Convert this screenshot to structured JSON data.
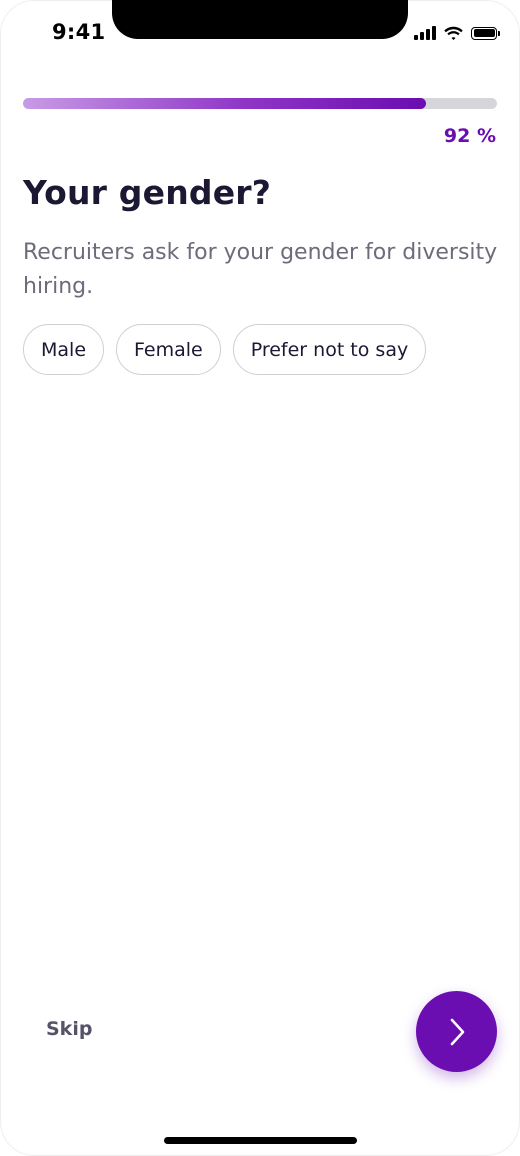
{
  "status_bar": {
    "time": "9:41",
    "signal_icon": "cellular-signal-icon",
    "wifi_icon": "wifi-icon",
    "battery_icon": "battery-icon"
  },
  "progress": {
    "value_percent": 92,
    "label": "92 %",
    "fill_color": "#6a0db1"
  },
  "question": {
    "title": "Your gender?",
    "subtitle": "Recruiters ask for your gender for diversity hiring."
  },
  "options": [
    {
      "label": "Male"
    },
    {
      "label": "Female"
    },
    {
      "label": "Prefer not to say"
    }
  ],
  "footer": {
    "skip_label": "Skip",
    "next_icon": "chevron-right-icon",
    "accent_color": "#6a0db1"
  }
}
